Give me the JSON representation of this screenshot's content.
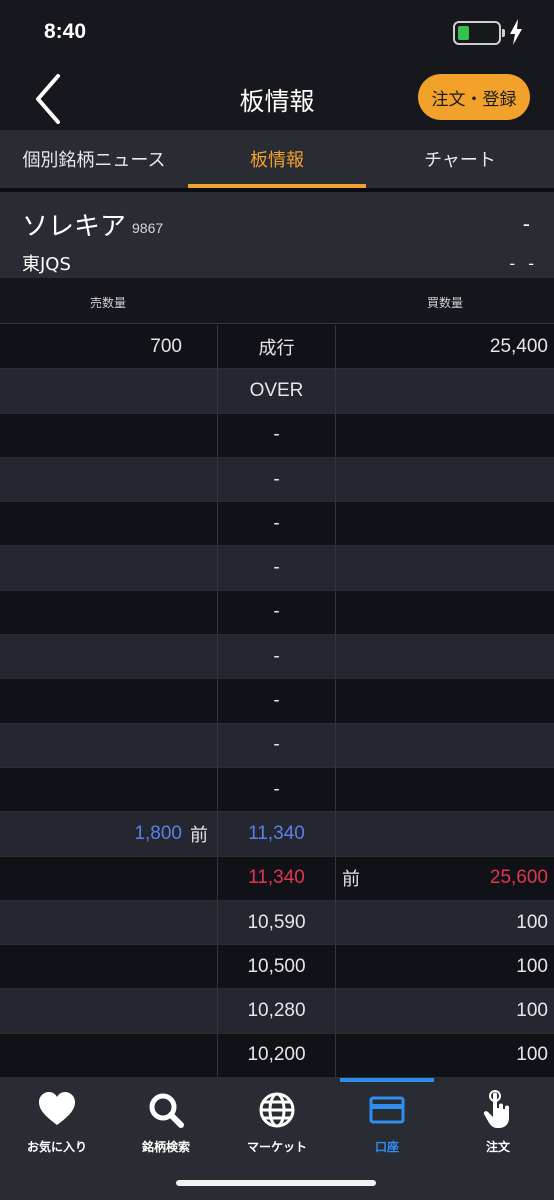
{
  "status_bar": {
    "time": "8:40",
    "battery_level": 0.3,
    "charging": true
  },
  "nav": {
    "title": "板情報",
    "order_button": "注文・登録"
  },
  "tabs": [
    {
      "label": "個別銘柄ニュース",
      "active": false
    },
    {
      "label": "板情報",
      "active": true
    },
    {
      "label": "チャート",
      "active": false
    }
  ],
  "stock": {
    "name": "ソレキア",
    "code": "9867",
    "market": "東JQS",
    "price": "-",
    "change": "- -"
  },
  "board": {
    "header": {
      "sell_qty": "売数量",
      "buy_qty": "買数量"
    },
    "rows": [
      {
        "sell": "700",
        "sell_mark": "",
        "price": "成行",
        "buy_mark": "",
        "buy": "25,400",
        "price_color": ""
      },
      {
        "sell": "",
        "sell_mark": "",
        "price": "OVER",
        "buy_mark": "",
        "buy": "",
        "price_color": ""
      },
      {
        "sell": "",
        "sell_mark": "",
        "price": "-",
        "buy_mark": "",
        "buy": "",
        "price_color": ""
      },
      {
        "sell": "",
        "sell_mark": "",
        "price": "-",
        "buy_mark": "",
        "buy": "",
        "price_color": ""
      },
      {
        "sell": "",
        "sell_mark": "",
        "price": "-",
        "buy_mark": "",
        "buy": "",
        "price_color": ""
      },
      {
        "sell": "",
        "sell_mark": "",
        "price": "-",
        "buy_mark": "",
        "buy": "",
        "price_color": ""
      },
      {
        "sell": "",
        "sell_mark": "",
        "price": "-",
        "buy_mark": "",
        "buy": "",
        "price_color": ""
      },
      {
        "sell": "",
        "sell_mark": "",
        "price": "-",
        "buy_mark": "",
        "buy": "",
        "price_color": ""
      },
      {
        "sell": "",
        "sell_mark": "",
        "price": "-",
        "buy_mark": "",
        "buy": "",
        "price_color": ""
      },
      {
        "sell": "",
        "sell_mark": "",
        "price": "-",
        "buy_mark": "",
        "buy": "",
        "price_color": ""
      },
      {
        "sell": "",
        "sell_mark": "",
        "price": "-",
        "buy_mark": "",
        "buy": "",
        "price_color": ""
      },
      {
        "sell": "1,800",
        "sell_mark": "前",
        "price": "11,340",
        "buy_mark": "",
        "buy": "",
        "price_color": "blue"
      },
      {
        "sell": "",
        "sell_mark": "",
        "price": "11,340",
        "buy_mark": "前",
        "buy": "25,600",
        "price_color": "red"
      },
      {
        "sell": "",
        "sell_mark": "",
        "price": "10,590",
        "buy_mark": "",
        "buy": "100",
        "price_color": ""
      },
      {
        "sell": "",
        "sell_mark": "",
        "price": "10,500",
        "buy_mark": "",
        "buy": "100",
        "price_color": ""
      },
      {
        "sell": "",
        "sell_mark": "",
        "price": "10,280",
        "buy_mark": "",
        "buy": "100",
        "price_color": ""
      },
      {
        "sell": "",
        "sell_mark": "",
        "price": "10,200",
        "buy_mark": "",
        "buy": "100",
        "price_color": ""
      }
    ]
  },
  "bottom_nav": [
    {
      "label": "お気に入り",
      "icon": "heart-icon",
      "active": false
    },
    {
      "label": "銘柄検索",
      "icon": "search-icon",
      "active": false
    },
    {
      "label": "マーケット",
      "icon": "globe-icon",
      "active": false
    },
    {
      "label": "口座",
      "icon": "card-icon",
      "active": true
    },
    {
      "label": "注文",
      "icon": "hand-pointer-icon",
      "active": false
    }
  ],
  "colors": {
    "accent": "#f2a12b",
    "active_blue": "#2f8df0",
    "sell_blue": "#5b7fe6",
    "buy_red": "#e0364f"
  }
}
